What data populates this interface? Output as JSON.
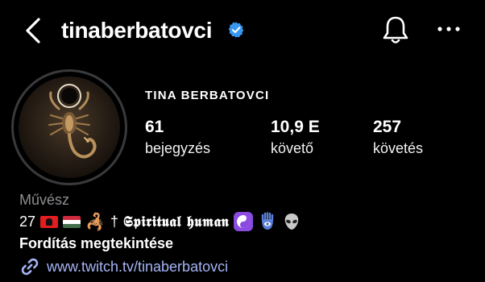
{
  "header": {
    "username": "tinaberbatovci",
    "back_icon": "chevron-left-icon",
    "verified_icon": "verified-badge-icon",
    "bell_icon": "bell-icon",
    "more_icon": "more-horizontal-icon"
  },
  "profile": {
    "full_name": "TINA BERBATOVCI",
    "stats": [
      {
        "value": "61",
        "label": "bejegyzés"
      },
      {
        "value": "10,9 E",
        "label": "követő"
      },
      {
        "value": "257",
        "label": "követés"
      }
    ],
    "category": "Művész",
    "bio": {
      "age": "27",
      "flag_1": "albania-flag",
      "flag_2": "hungary-flag",
      "scorpion_emoji": "🦂",
      "cross": "†",
      "text": "𝕾𝖕𝖎𝖗𝖎𝖙𝖚𝖆𝖑 𝖍𝖚𝖒𝖆𝖓",
      "emojis": [
        "yin-yang",
        "hamsa",
        "alien"
      ]
    },
    "translate_label": "Fordítás megtekintése",
    "link_icon": "link-icon",
    "link": "www.twitch.tv/tinaberbatovci"
  },
  "colors": {
    "background": "#000000",
    "verified": "#3897f0",
    "link": "#a5b4f5",
    "muted": "#8e8e93"
  }
}
